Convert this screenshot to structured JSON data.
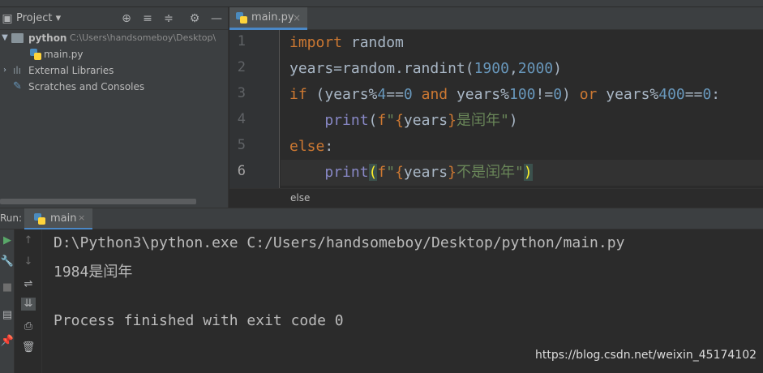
{
  "project_panel": {
    "title": "Project",
    "tree": [
      {
        "label": "python",
        "path": "C:\\Users\\handsomeboy\\Desktop\\"
      },
      {
        "label": "main.py"
      },
      {
        "label": "External Libraries"
      },
      {
        "label": "Scratches and Consoles"
      }
    ]
  },
  "editor": {
    "tab_label": "main.py",
    "tab_close": "×",
    "line_numbers": [
      "1",
      "2",
      "3",
      "4",
      "5",
      "6"
    ],
    "breadcrumb": "else"
  },
  "run_panel": {
    "label": "Run:",
    "tab_label": "main",
    "tab_close": "×",
    "output": [
      "D:\\Python3\\python.exe C:/Users/handsomeboy/Desktop/python/main.py",
      "1984是闰年",
      "",
      "Process finished with exit code 0"
    ]
  },
  "watermark": "https://blog.csdn.net/weixin_45174102",
  "colors": {
    "keyword": "#cc7832",
    "number": "#6897bb",
    "string": "#6a8759",
    "builtin": "#8888c6",
    "accent": "#4a88c7"
  }
}
